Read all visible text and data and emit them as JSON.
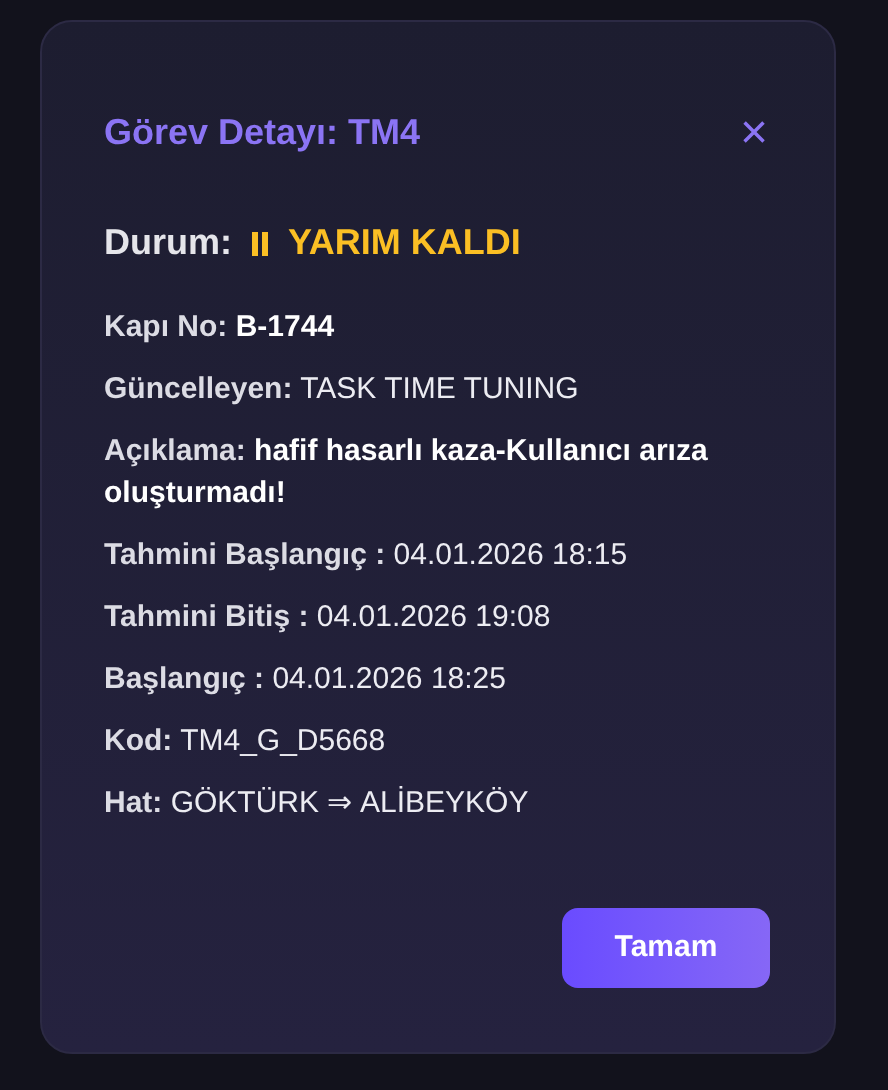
{
  "dialog": {
    "title": "Görev Detayı: TM4",
    "close": "×",
    "status": {
      "label": "Durum:",
      "value": "YARIM KALDI",
      "color": "#fbbf24"
    },
    "fields": [
      {
        "label": "Kapı No:",
        "value": "B-1744",
        "value_bold": true
      },
      {
        "label": "Güncelleyen:",
        "value": "TASK TIME TUNING",
        "value_bold": false
      },
      {
        "label": "Açıklama:",
        "value": "hafif hasarlı kaza-Kullanıcı arıza oluşturmadı!",
        "value_bold": true
      },
      {
        "label": "Tahmini Başlangıç :",
        "value": "04.01.2026 18:15",
        "value_bold": false
      },
      {
        "label": "Tahmini Bitiş :",
        "value": "04.01.2026 19:08",
        "value_bold": false
      },
      {
        "label": "Başlangıç :",
        "value": "04.01.2026 18:25",
        "value_bold": false
      },
      {
        "label": "Kod:",
        "value": "TM4_G_D5668",
        "value_bold": false
      },
      {
        "label": "Hat:",
        "value": "GÖKTÜRK ⇒ ALİBEYKÖY",
        "value_bold": false
      }
    ],
    "buttons": [
      "Tamam"
    ]
  }
}
